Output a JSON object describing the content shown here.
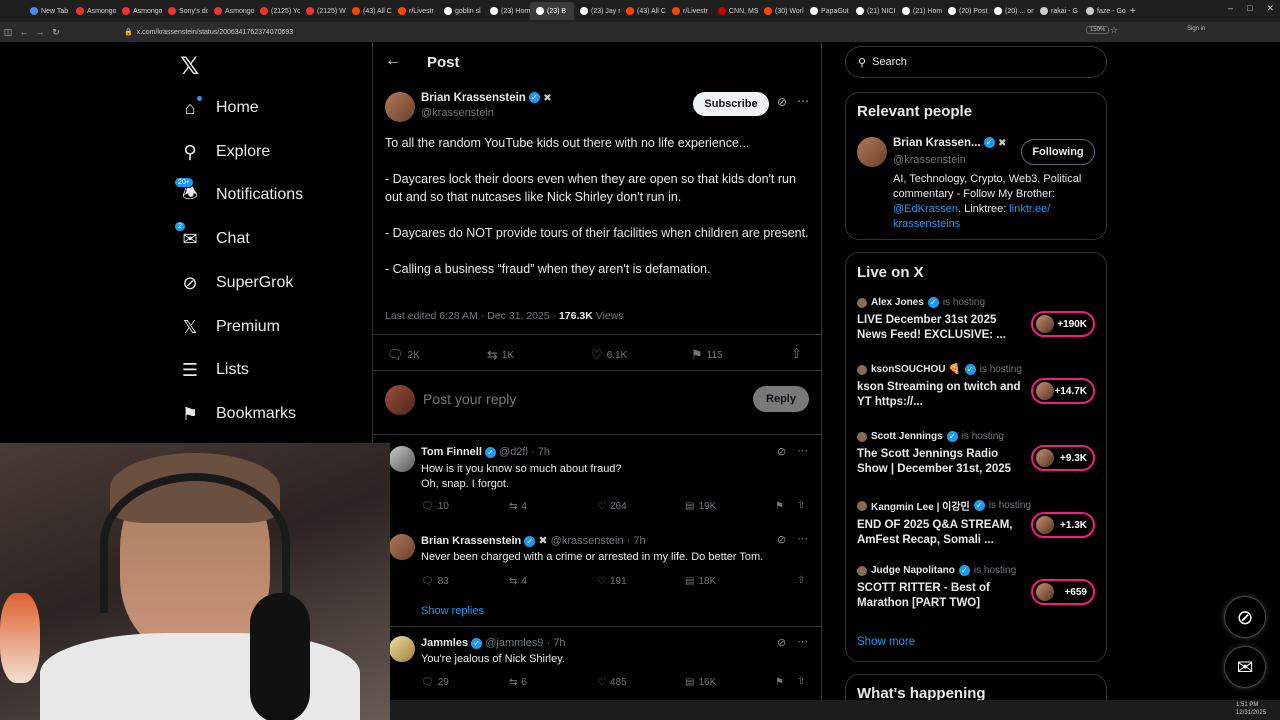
{
  "browser": {
    "tabs": [
      {
        "label": "New Tab",
        "color": "#4a8af4"
      },
      {
        "label": "Asmongo",
        "color": "#e33"
      },
      {
        "label": "Asmongo",
        "color": "#e33"
      },
      {
        "label": "Sony's do",
        "color": "#e33"
      },
      {
        "label": "Asmongo",
        "color": "#e33"
      },
      {
        "label": "(2125) Yo",
        "color": "#e33"
      },
      {
        "label": "(2125) W",
        "color": "#e33"
      },
      {
        "label": "(43) All C",
        "color": "#ff4500"
      },
      {
        "label": "r/Livestr",
        "color": "#ff4500"
      },
      {
        "label": "goblin sl",
        "color": "#fff"
      },
      {
        "label": "(23) Hom",
        "color": "#fff"
      },
      {
        "label": "(23) B",
        "color": "#fff",
        "active": true
      },
      {
        "label": "(23) Jay r",
        "color": "#fff"
      },
      {
        "label": "(43) All C",
        "color": "#ff4500"
      },
      {
        "label": "r/Livestr",
        "color": "#ff4500"
      },
      {
        "label": "CNN, MS",
        "color": "#c00"
      },
      {
        "label": "(30) Worl",
        "color": "#ff4500"
      },
      {
        "label": "PapaGut",
        "color": "#fff"
      },
      {
        "label": "(21) NICI",
        "color": "#fff"
      },
      {
        "label": "(21) Hom",
        "color": "#fff"
      },
      {
        "label": "(20) Post",
        "color": "#fff"
      },
      {
        "label": "(20) ... on",
        "color": "#fff"
      },
      {
        "label": "rakai - G",
        "color": "#ccc"
      },
      {
        "label": "faze - Go",
        "color": "#ccc"
      }
    ],
    "url": "x.com/krassenstein/status/2006341762374070693",
    "zoom": "150%",
    "signin": "Sign in"
  },
  "nav": {
    "items": [
      {
        "label": "Home",
        "icon": "home-icon"
      },
      {
        "label": "Explore",
        "icon": "search-icon"
      },
      {
        "label": "Notifications",
        "icon": "bell-icon",
        "badge": "20+"
      },
      {
        "label": "Chat",
        "icon": "mail-icon",
        "badge": "2"
      },
      {
        "label": "SuperGrok",
        "icon": "grok-icon"
      },
      {
        "label": "Premium",
        "icon": "x-logo-icon"
      },
      {
        "label": "Lists",
        "icon": "list-icon"
      },
      {
        "label": "Bookmarks",
        "icon": "bookmark-icon"
      }
    ]
  },
  "post": {
    "header": "Post",
    "author": "Brian Krassenstein",
    "handle": "@krassenstein",
    "subscribe": "Subscribe",
    "lines": [
      "To all the random YouTube kids out there with no life experience...",
      "- Daycares lock their doors even when they are open so that kids don't run out and so that nutcases like Nick Shirley don't run in.",
      "- Daycares do NOT provide tours of their facilities when children are present.",
      "- Calling a business “fraud” when they aren't is defamation."
    ],
    "meta_date": "Last edited 6:28 AM · Dec 31, 2025 · ",
    "views_count": "176.3K",
    "views_label": " Views",
    "replies": "2K",
    "reposts": "1K",
    "likes": "6.1K",
    "bookmarks": "115",
    "reply_placeholder": "Post your reply",
    "reply_button": "Reply"
  },
  "replies": [
    {
      "name": "Tom Finnell",
      "handle": "@d2fl",
      "time": "· 7h",
      "lines": [
        "How is it you know so much about fraud?",
        "Oh, snap. I forgot."
      ],
      "replies": "10",
      "reposts": "4",
      "likes": "264",
      "views": "19K"
    },
    {
      "name": "Brian Krassenstein",
      "handle": "@krassenstein",
      "time": "· 7h",
      "lines": [
        "Never been charged with a crime or arrested in my life. Do better Tom."
      ],
      "replies": "83",
      "reposts": "4",
      "likes": "191",
      "views": "18K"
    },
    {
      "name": "Jammles",
      "handle": "@jammles9",
      "time": "· 7h",
      "lines": [
        "You're jealous of Nick Shirley."
      ],
      "replies": "29",
      "reposts": "6",
      "likes": "485",
      "views": "16K"
    }
  ],
  "show_replies": "Show replies",
  "right": {
    "search_placeholder": "Search",
    "relevant_title": "Relevant people",
    "person": {
      "name": "Brian Krassen...",
      "handle": "@krassenstein",
      "follow": "Following",
      "bio1": "AI, Technology, Crypto, Web3, Political commentary - Follow My Brother: ",
      "bio_mention": "@EdKrassen",
      "bio2": ". Linktree: ",
      "bio_link": "linktr.ee/ krassensteins"
    },
    "live_title": "Live on X",
    "is_hosting": "is hosting",
    "live": [
      {
        "host": "Alex Jones",
        "title": "LIVE December 31st 2025 News Feed! EXCLUSIVE: ...",
        "count": "+190K"
      },
      {
        "host": "ksonSOUCHOU 🍕",
        "title": "kson Streaming on twitch and YT https://...",
        "count": "+14.7K"
      },
      {
        "host": "Scott Jennings",
        "title": "The Scott Jennings Radio Show | December 31st, 2025",
        "count": "+9.3K"
      },
      {
        "host": "Kangmin Lee | 이강민",
        "title": "END OF 2025 Q&A STREAM, AmFest Recap, Somali ...",
        "count": "+1.3K"
      },
      {
        "host": "Judge Napolitano",
        "title": "SCOTT RITTER -  Best of Marathon  [PART TWO]",
        "count": "+659"
      }
    ],
    "show_more": "Show more",
    "whats_happening": "What's happening"
  },
  "taskbar": {
    "time": "1:51 PM",
    "date": "12/31/2025"
  }
}
